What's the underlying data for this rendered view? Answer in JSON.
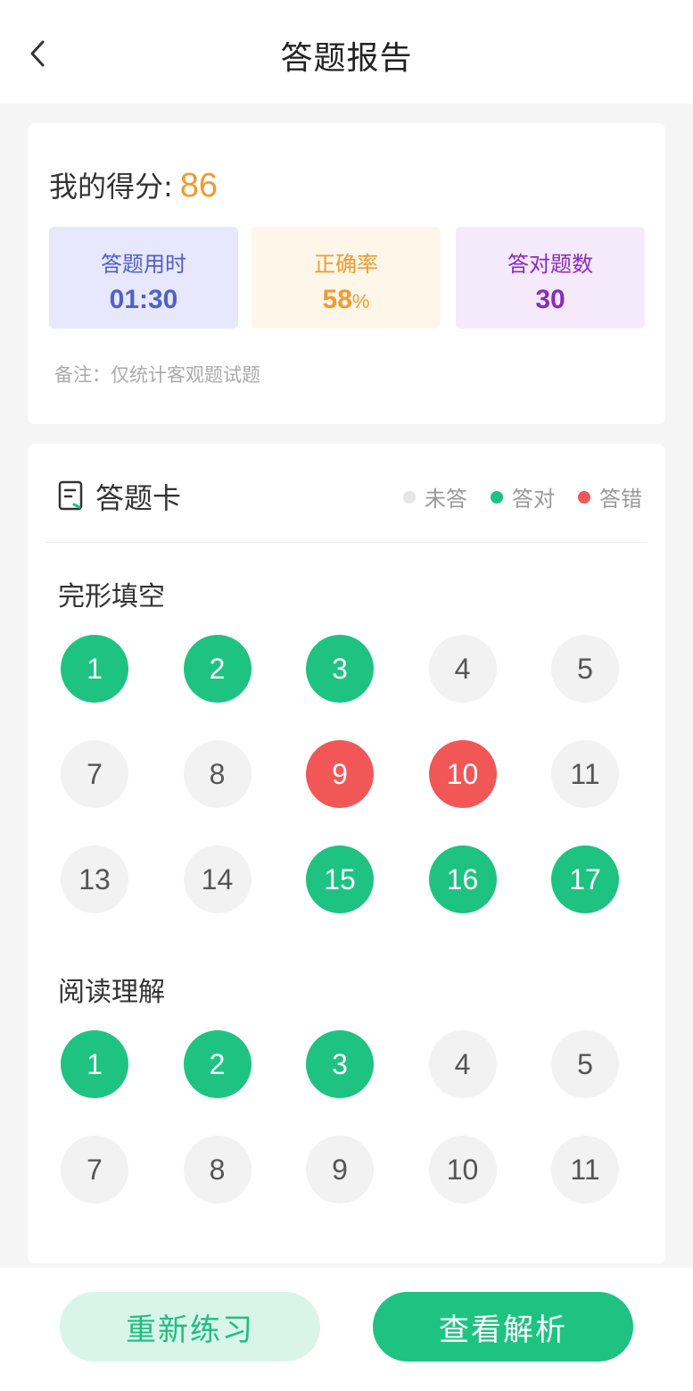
{
  "header": {
    "title": "答题报告"
  },
  "score": {
    "label": "我的得分:",
    "value": "86"
  },
  "stats": {
    "time": {
      "label": "答题用时",
      "value": "01:30"
    },
    "rate": {
      "label": "正确率",
      "value": "58",
      "unit": "%"
    },
    "count": {
      "label": "答对题数",
      "value": "30"
    }
  },
  "note": "备注：仅统计客观题试题",
  "answer_card": {
    "title": "答题卡",
    "legend": {
      "none": "未答",
      "right": "答对",
      "wrong": "答错"
    }
  },
  "sections": [
    {
      "title": "完形填空",
      "questions": [
        {
          "n": "1",
          "s": "right"
        },
        {
          "n": "2",
          "s": "right"
        },
        {
          "n": "3",
          "s": "right"
        },
        {
          "n": "4",
          "s": "none"
        },
        {
          "n": "5",
          "s": "none"
        },
        {
          "n": "7",
          "s": "none"
        },
        {
          "n": "8",
          "s": "none"
        },
        {
          "n": "9",
          "s": "wrong"
        },
        {
          "n": "10",
          "s": "wrong"
        },
        {
          "n": "11",
          "s": "none"
        },
        {
          "n": "13",
          "s": "none"
        },
        {
          "n": "14",
          "s": "none"
        },
        {
          "n": "15",
          "s": "right"
        },
        {
          "n": "16",
          "s": "right"
        },
        {
          "n": "17",
          "s": "right"
        }
      ]
    },
    {
      "title": "阅读理解",
      "questions": [
        {
          "n": "1",
          "s": "right"
        },
        {
          "n": "2",
          "s": "right"
        },
        {
          "n": "3",
          "s": "right"
        },
        {
          "n": "4",
          "s": "none"
        },
        {
          "n": "5",
          "s": "none"
        },
        {
          "n": "7",
          "s": "none"
        },
        {
          "n": "8",
          "s": "none"
        },
        {
          "n": "9",
          "s": "none"
        },
        {
          "n": "10",
          "s": "none"
        },
        {
          "n": "11",
          "s": "none"
        }
      ]
    }
  ],
  "footer": {
    "retry_label": "重新练习",
    "view_label": "查看解析"
  },
  "colors": {
    "green": "#1ec381",
    "red": "#f25757",
    "orange": "#f39a2b",
    "purple": "#8b2ac0",
    "blue": "#4f61c9"
  },
  "icons": {
    "back": "chevron-left-icon",
    "card": "answer-sheet-icon"
  }
}
